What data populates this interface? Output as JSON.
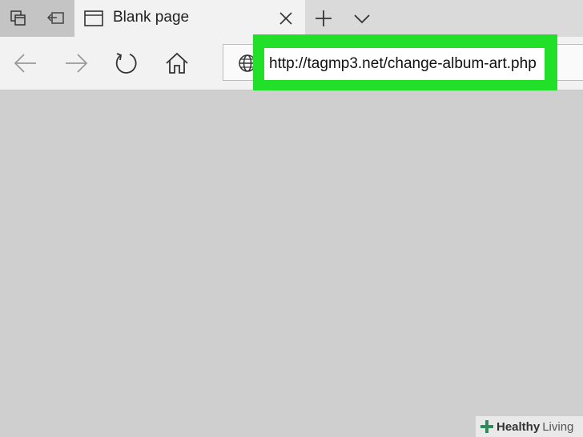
{
  "browser": {
    "tab": {
      "title": "Blank page"
    },
    "address_bar": {
      "url": "http://tagmp3.net/change-album-art.php"
    },
    "icons": {
      "tab_preview": "tab-preview-icon",
      "tabs_aside": "tabs-aside-icon",
      "page": "page-icon",
      "close": "close-icon",
      "new_tab": "plus-icon",
      "tab_menu": "chevron-down-icon",
      "back": "back-arrow-icon",
      "forward": "forward-arrow-icon",
      "refresh": "refresh-icon",
      "home": "home-icon",
      "site_info": "globe-icon"
    },
    "colors": {
      "highlight": "#22e02a",
      "page_background": "#cfcfcf"
    }
  },
  "watermark": {
    "strong": "Healthy",
    "light": "Living"
  }
}
